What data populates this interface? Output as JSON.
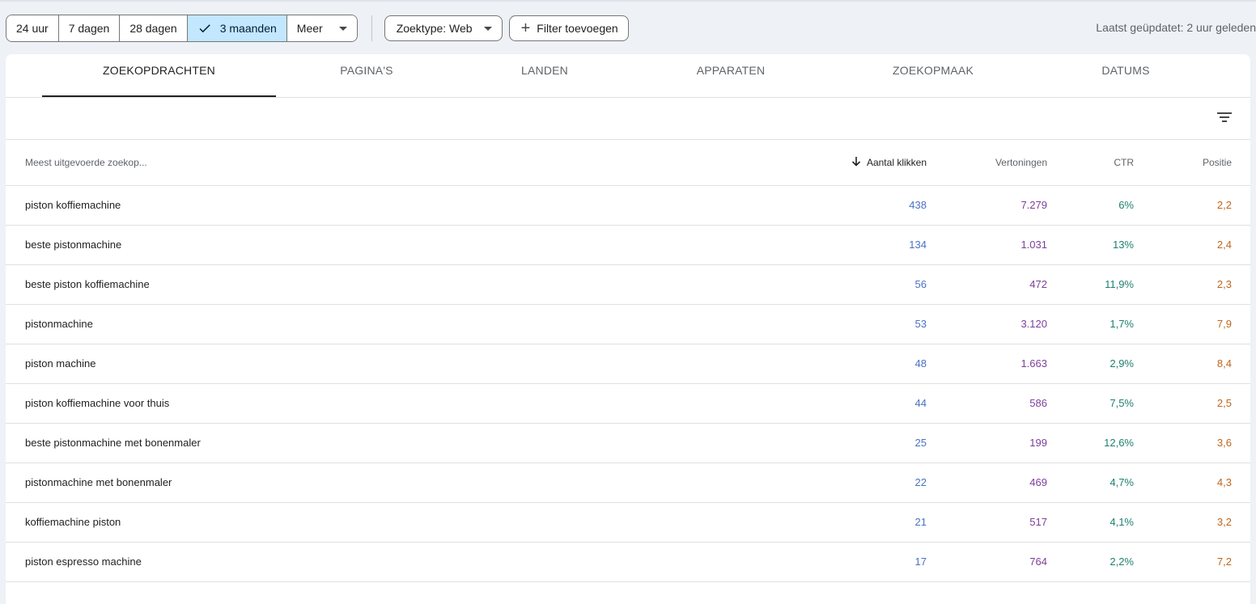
{
  "date_range": {
    "options": [
      "24 uur",
      "7 dagen",
      "28 dagen",
      "3 maanden"
    ],
    "selected_index": 3,
    "more_label": "Meer"
  },
  "filters": {
    "search_type": "Zoektype: Web",
    "add_filter": "Filter toevoegen"
  },
  "last_updated": "Laatst geüpdatet: 2 uur geleden",
  "tabs": [
    "ZOEKOPDRACHTEN",
    "PAGINA'S",
    "LANDEN",
    "APPARATEN",
    "ZOEKOPMAAK",
    "DATUMS"
  ],
  "active_tab_index": 0,
  "table": {
    "headers": {
      "query": "Meest uitgevoerde zoekop...",
      "clicks": "Aantal klikken",
      "impressions": "Vertoningen",
      "ctr": "CTR",
      "position": "Positie"
    },
    "sorted_by": "clicks",
    "rows": [
      {
        "query": "piston koffiemachine",
        "clicks": "438",
        "impressions": "7.279",
        "ctr": "6%",
        "position": "2,2"
      },
      {
        "query": "beste pistonmachine",
        "clicks": "134",
        "impressions": "1.031",
        "ctr": "13%",
        "position": "2,4"
      },
      {
        "query": "beste piston koffiemachine",
        "clicks": "56",
        "impressions": "472",
        "ctr": "11,9%",
        "position": "2,3"
      },
      {
        "query": "pistonmachine",
        "clicks": "53",
        "impressions": "3.120",
        "ctr": "1,7%",
        "position": "7,9"
      },
      {
        "query": "piston machine",
        "clicks": "48",
        "impressions": "1.663",
        "ctr": "2,9%",
        "position": "8,4"
      },
      {
        "query": "piston koffiemachine voor thuis",
        "clicks": "44",
        "impressions": "586",
        "ctr": "7,5%",
        "position": "2,5"
      },
      {
        "query": "beste pistonmachine met bonenmaler",
        "clicks": "25",
        "impressions": "199",
        "ctr": "12,6%",
        "position": "3,6"
      },
      {
        "query": "pistonmachine met bonenmaler",
        "clicks": "22",
        "impressions": "469",
        "ctr": "4,7%",
        "position": "4,3"
      },
      {
        "query": "koffiemachine piston",
        "clicks": "21",
        "impressions": "517",
        "ctr": "4,1%",
        "position": "3,2"
      },
      {
        "query": "piston espresso machine",
        "clicks": "17",
        "impressions": "764",
        "ctr": "2,2%",
        "position": "7,2"
      }
    ]
  },
  "colors": {
    "clicks": "#4a72c2",
    "impressions": "#7b3f9a",
    "ctr": "#1e8070",
    "position": "#c0661a",
    "selected_chip": "#c2e7ff"
  }
}
